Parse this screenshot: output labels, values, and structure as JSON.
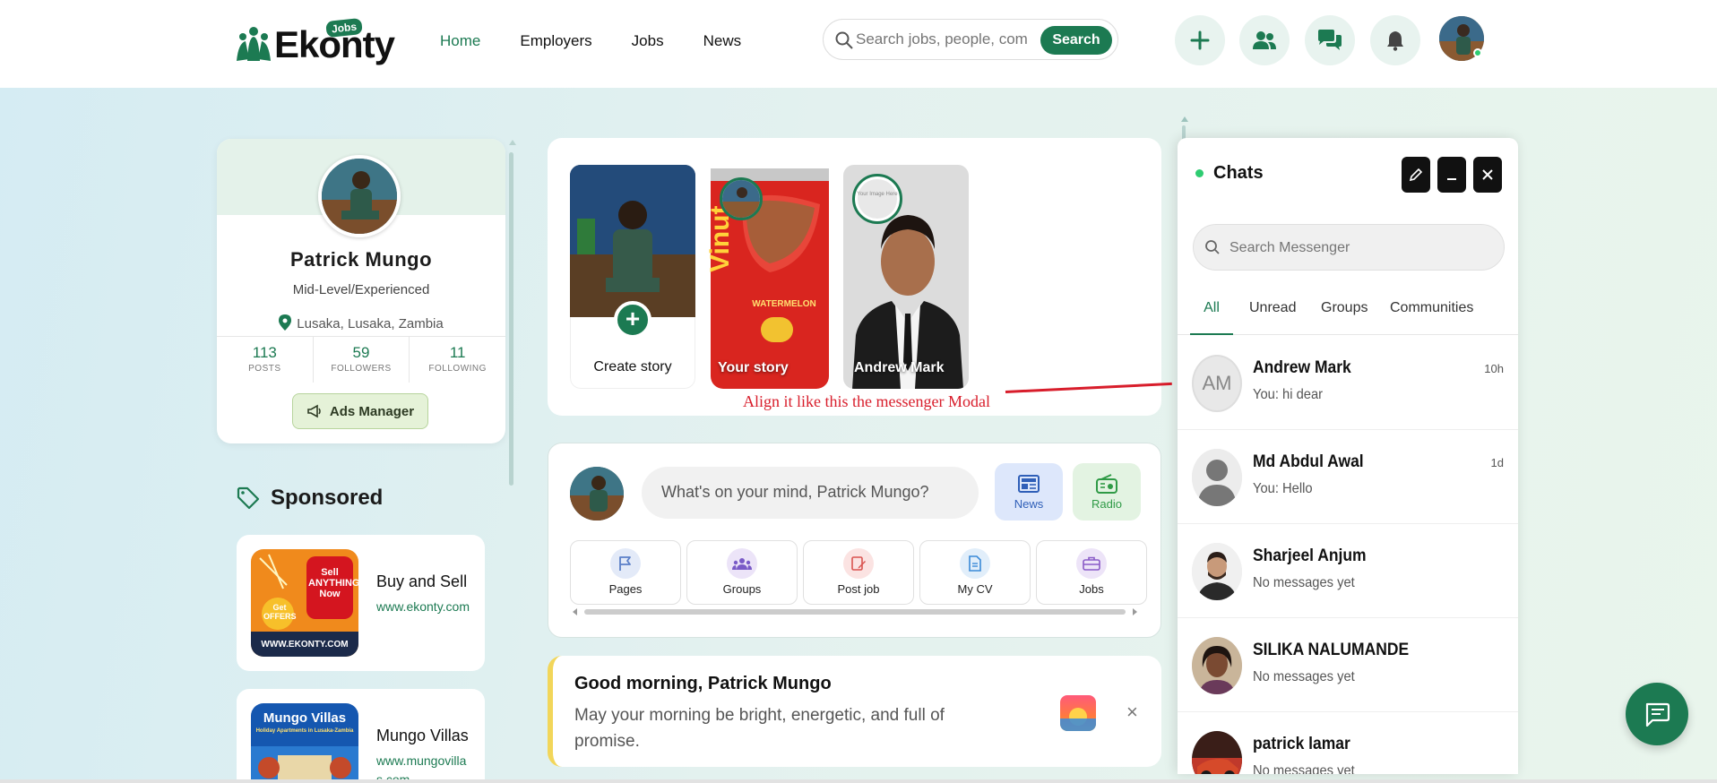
{
  "header": {
    "logo_text": "Ekonty",
    "logo_badge": "Jobs",
    "nav": [
      {
        "label": "Home",
        "active": true
      },
      {
        "label": "Employers",
        "active": false
      },
      {
        "label": "Jobs",
        "active": false
      },
      {
        "label": "News",
        "active": false
      }
    ],
    "search_placeholder": "Search jobs, people, com",
    "search_button": "Search",
    "icons": [
      "plus-icon",
      "people-icon",
      "chat-icon",
      "bell-icon"
    ]
  },
  "profile": {
    "name": "Patrick Mungo",
    "level": "Mid-Level/Experienced",
    "location": "Lusaka, Lusaka, Zambia",
    "stats": [
      {
        "value": "113",
        "label": "POSTS"
      },
      {
        "value": "59",
        "label": "FOLLOWERS"
      },
      {
        "value": "11",
        "label": "FOLLOWING"
      }
    ],
    "ads_button": "Ads Manager"
  },
  "sponsored": {
    "title": "Sponsored",
    "items": [
      {
        "title": "Buy and Sell",
        "url": "www.ekonty.com",
        "image_text": "WWW.EKONTY.COM",
        "image_sub": "Sell ANYTHING Now",
        "image_get": "Get OFFERS"
      },
      {
        "title": "Mungo Villas",
        "url": "www.mungovillas.com",
        "image_text": "Mungo Villas",
        "image_sub": "Holiday Apartments in Lusaka-Zambia"
      }
    ]
  },
  "stories": {
    "items": [
      {
        "label": "Create story",
        "type": "create"
      },
      {
        "label": "Your story",
        "type": "story"
      },
      {
        "label": "Andrew Mark",
        "type": "story"
      }
    ],
    "can_text": "Vinut",
    "can_sub": "WATERMELON",
    "ring_text": "Your Image Here"
  },
  "annotation": "Align it like this the messenger Modal",
  "composer": {
    "placeholder": "What's on your mind, Patrick Mungo?",
    "buttons": [
      {
        "label": "News",
        "icon": "news-icon"
      },
      {
        "label": "Radio",
        "icon": "radio-icon"
      }
    ],
    "quick_actions": [
      {
        "label": "Pages",
        "icon": "flag-icon",
        "color": "#5b7fc7"
      },
      {
        "label": "Groups",
        "icon": "groups-icon",
        "color": "#7a5bc7"
      },
      {
        "label": "Post job",
        "icon": "edit-icon",
        "color": "#d9534f"
      },
      {
        "label": "My CV",
        "icon": "document-icon",
        "color": "#3a8ad8"
      },
      {
        "label": "Jobs",
        "icon": "briefcase-icon",
        "color": "#8a5bc7"
      }
    ]
  },
  "greeting": {
    "title": "Good morning, Patrick Mungo",
    "text": "May your morning be bright, energetic, and full of promise.",
    "close": "×"
  },
  "chat": {
    "title": "Chats",
    "search_placeholder": "Search Messenger",
    "tabs": [
      "All",
      "Unread",
      "Groups",
      "Communities"
    ],
    "active_tab": "All",
    "conversations": [
      {
        "name": "Andrew Mark",
        "message": "You: hi dear",
        "time": "10h",
        "initials": "AM"
      },
      {
        "name": "Md Abdul Awal",
        "message": "You: Hello",
        "time": "1d",
        "initials": ""
      },
      {
        "name": "Sharjeel Anjum",
        "message": "No messages yet",
        "time": "",
        "initials": ""
      },
      {
        "name": "SILIKA NALUMANDE",
        "message": "No messages yet",
        "time": "",
        "initials": ""
      },
      {
        "name": "patrick lamar",
        "message": "No messages yet",
        "time": "",
        "initials": ""
      }
    ]
  },
  "colors": {
    "brand": "#1c7a52",
    "annotation": "#d81d2b",
    "greeting_accent": "#f2d65a"
  }
}
